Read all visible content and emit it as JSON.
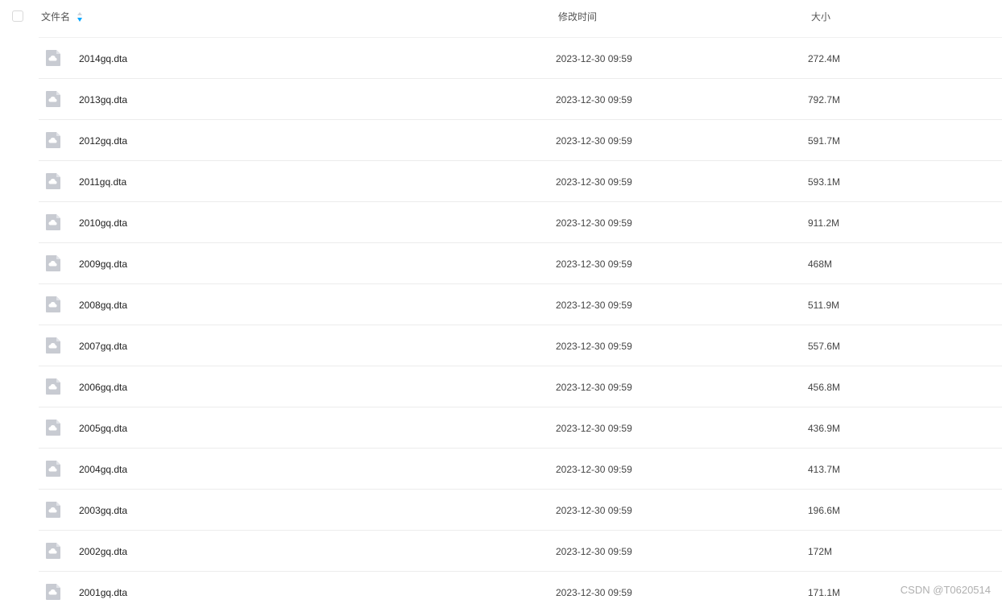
{
  "header": {
    "name_label": "文件名",
    "time_label": "修改时间",
    "size_label": "大小",
    "sort_icon": "sort-desc-icon"
  },
  "colors": {
    "sort_active": "#06a7ff",
    "file_icon": "#c8cbd2"
  },
  "files": [
    {
      "name": "2014gq.dta",
      "time": "2023-12-30 09:59",
      "size": "272.4M"
    },
    {
      "name": "2013gq.dta",
      "time": "2023-12-30 09:59",
      "size": "792.7M"
    },
    {
      "name": "2012gq.dta",
      "time": "2023-12-30 09:59",
      "size": "591.7M"
    },
    {
      "name": "2011gq.dta",
      "time": "2023-12-30 09:59",
      "size": "593.1M"
    },
    {
      "name": "2010gq.dta",
      "time": "2023-12-30 09:59",
      "size": "911.2M"
    },
    {
      "name": "2009gq.dta",
      "time": "2023-12-30 09:59",
      "size": "468M"
    },
    {
      "name": "2008gq.dta",
      "time": "2023-12-30 09:59",
      "size": "511.9M"
    },
    {
      "name": "2007gq.dta",
      "time": "2023-12-30 09:59",
      "size": "557.6M"
    },
    {
      "name": "2006gq.dta",
      "time": "2023-12-30 09:59",
      "size": "456.8M"
    },
    {
      "name": "2005gq.dta",
      "time": "2023-12-30 09:59",
      "size": "436.9M"
    },
    {
      "name": "2004gq.dta",
      "time": "2023-12-30 09:59",
      "size": "413.7M"
    },
    {
      "name": "2003gq.dta",
      "time": "2023-12-30 09:59",
      "size": "196.6M"
    },
    {
      "name": "2002gq.dta",
      "time": "2023-12-30 09:59",
      "size": "172M"
    },
    {
      "name": "2001gq.dta",
      "time": "2023-12-30 09:59",
      "size": "171.1M"
    }
  ],
  "watermark": "CSDN @T0620514"
}
